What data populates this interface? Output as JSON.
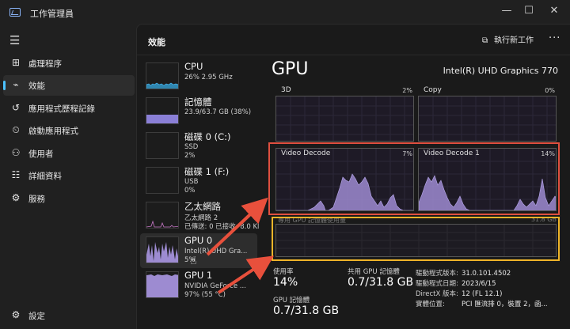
{
  "window": {
    "title": "工作管理員",
    "minimize": "—",
    "maximize": "☐",
    "close": "✕"
  },
  "nav": {
    "menu_icon": "hamburger-icon",
    "items": [
      {
        "label": "處理程序",
        "icon": "processes-icon"
      },
      {
        "label": "效能",
        "icon": "performance-icon",
        "active": true
      },
      {
        "label": "應用程式歷程記錄",
        "icon": "history-icon"
      },
      {
        "label": "啟動應用程式",
        "icon": "startup-icon"
      },
      {
        "label": "使用者",
        "icon": "users-icon"
      },
      {
        "label": "詳細資料",
        "icon": "details-icon"
      },
      {
        "label": "服務",
        "icon": "services-icon"
      }
    ],
    "settings": {
      "label": "設定",
      "icon": "gear-icon"
    }
  },
  "header": {
    "title": "效能",
    "run_task": "執行新工作",
    "more": "···"
  },
  "resources": [
    {
      "name": "CPU",
      "detail1": "26%  2.95 GHz",
      "detail2": ""
    },
    {
      "name": "記憶體",
      "detail1": "23.9/63.7 GB (38%)",
      "detail2": ""
    },
    {
      "name": "磁碟 0 (C:)",
      "detail1": "SSD",
      "detail2": "2%"
    },
    {
      "name": "磁碟 1 (F:)",
      "detail1": "USB",
      "detail2": "0%"
    },
    {
      "name": "乙太網路",
      "detail1": "乙太網路 2",
      "detail2": "已傳送: 0 已接收: 8.0 Kl"
    },
    {
      "name": "GPU 0",
      "detail1": "Intel(R) UHD Gra...",
      "detail2": "5%",
      "selected": true
    },
    {
      "name": "GPU 1",
      "detail1": "NVIDIA GeForce ...",
      "detail2": "97% (55 °C)"
    }
  ],
  "detail": {
    "title": "GPU",
    "model": "Intel(R) UHD Graphics 770",
    "graphs": [
      {
        "label": "3D",
        "percent": "2%"
      },
      {
        "label": "Copy",
        "percent": "0%"
      },
      {
        "label": "Video Decode",
        "percent": "7%"
      },
      {
        "label": "Video Decode 1",
        "percent": "14%"
      }
    ],
    "memory_graph": {
      "label": "專用 GPU 記憶體使用量",
      "max": "31.8 GB"
    },
    "stats": {
      "utilization_label": "使用率",
      "utilization_value": "14%",
      "shared_mem_label": "共用 GPU 記憶體",
      "shared_mem_value": "0.7/31.8 GB",
      "gpu_mem_label": "GPU 記憶體",
      "gpu_mem_value": "0.7/31.8 GB"
    },
    "info": [
      {
        "k": "驅動程式版本:",
        "v": "31.0.101.4502"
      },
      {
        "k": "驅動程式日期:",
        "v": "2023/6/15"
      },
      {
        "k": "DirectX 版本:",
        "v": "12 (FL 12.1)"
      },
      {
        "k": "實體位置:",
        "v": "PCI 匯流排 0，裝置 2，函..."
      }
    ]
  },
  "colors": {
    "accent": "#4cc2ff",
    "graph_fill": "#9d8bd1",
    "red_box": "#e05040",
    "yellow_box": "#f0b429"
  }
}
